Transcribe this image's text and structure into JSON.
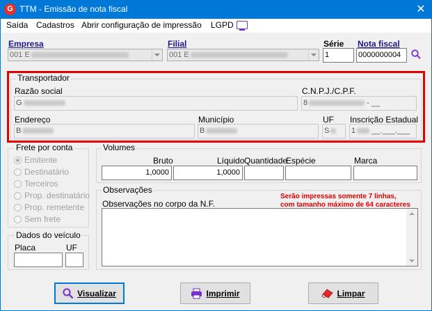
{
  "window": {
    "title": "TTM - Emissão de nota fiscal",
    "app_icon": "G",
    "close_glyph": "✕"
  },
  "menu": {
    "items": [
      "Saída",
      "Cadastros",
      "Abrir configuração de impressão",
      "LGPD"
    ],
    "lgpd_icon": "monitor-icon"
  },
  "header": {
    "empresa_label": "Empresa",
    "empresa_value": "001 E",
    "filial_label": "Filial",
    "filial_value": "001 E",
    "serie_label": "Série",
    "serie_value": "1",
    "nota_label": "Nota fiscal",
    "nota_value": "0000000004"
  },
  "transportador": {
    "title": "Transportador",
    "razao_label": "Razão social",
    "razao_value": "G",
    "cnpj_label": "C.N.P.J./C.P.F.",
    "cnpj_value": "8",
    "endereco_label": "Endereço",
    "endereco_value": "B",
    "municipio_label": "Município",
    "municipio_value": "B",
    "uf_label": "UF",
    "uf_value": "S",
    "ie_label": "Inscrição Estadual",
    "ie_value": "1",
    "cnpj_mask_tail": "- __",
    "ie_mask_tail": "__.___.___"
  },
  "frete": {
    "title": "Frete por conta",
    "options": [
      "Emitente",
      "Destinatário",
      "Terceiros",
      "Prop. destinatário",
      "Prop. remetente",
      "Sem frete"
    ],
    "selected_index": 0
  },
  "volumes": {
    "title": "Volumes",
    "bruto_label": "Bruto",
    "bruto_value": "1,0000",
    "liquido_label": "Líquido",
    "liquido_value": "1,0000",
    "quantidade_label": "Quantidade",
    "quantidade_value": "",
    "especie_label": "Espécie",
    "especie_value": "",
    "marca_label": "Marca",
    "marca_value": ""
  },
  "observacoes": {
    "title": "Observações",
    "label": "Observações no corpo da N.F.",
    "note_line1": "Serão impressas somente 7 linhas,",
    "note_line2": "com tamanho máximo de 64 caracteres",
    "value": ""
  },
  "veiculo": {
    "title": "Dados do veículo",
    "placa_label": "Placa",
    "placa_value": "",
    "uf_label": "UF",
    "uf_value": ""
  },
  "buttons": {
    "visualizar": "Visualizar",
    "imprimir": "Imprimir",
    "limpar": "Limpar"
  },
  "colors": {
    "titlebar": "#0078d7",
    "highlight": "#e60000",
    "label_blue": "#1a1a8c",
    "note_red": "#e00000"
  }
}
